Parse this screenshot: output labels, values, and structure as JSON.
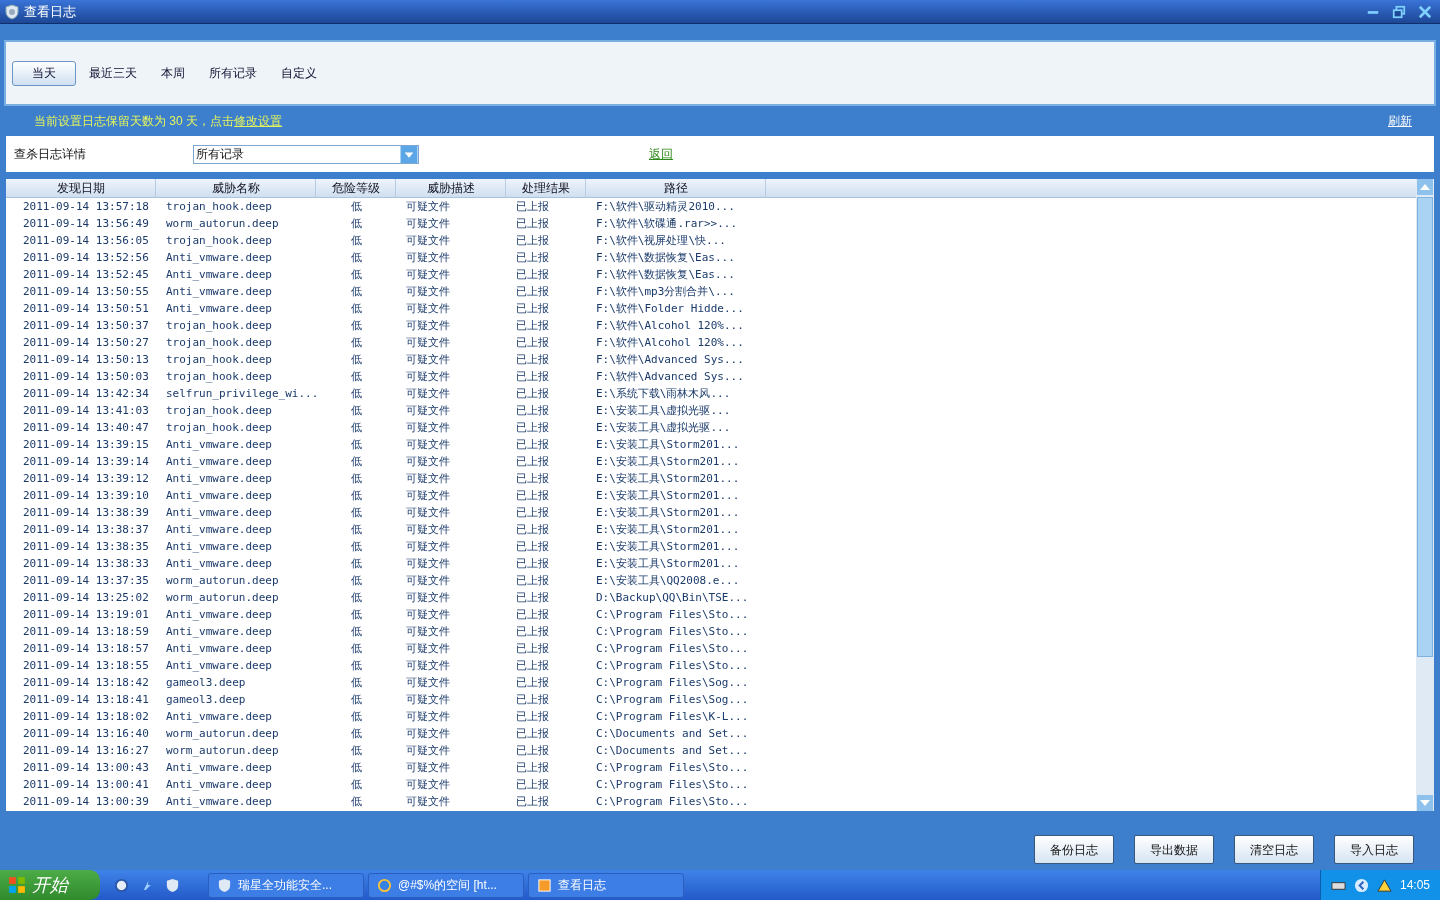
{
  "window": {
    "title": "查看日志"
  },
  "tabs": [
    {
      "label": "当天",
      "selected": true
    },
    {
      "label": "最近三天",
      "selected": false
    },
    {
      "label": "本周",
      "selected": false
    },
    {
      "label": "所有记录",
      "selected": false
    },
    {
      "label": "自定义",
      "selected": false
    }
  ],
  "notice": {
    "text": "当前设置日志保留天数为 30 天，点击",
    "link": "修改设置"
  },
  "refresh_link": "刷新",
  "filter": {
    "label": "查杀日志详情",
    "value": "所有记录"
  },
  "back_link": "返回",
  "table": {
    "columns": [
      "发现日期",
      "威胁名称",
      "危险等级",
      "威胁描述",
      "处理结果",
      "路径"
    ],
    "rows": [
      [
        "2011-09-14 13:57:18",
        "trojan_hook.deep",
        "低",
        "可疑文件",
        "已上报",
        "F:\\软件\\驱动精灵2010..."
      ],
      [
        "2011-09-14 13:56:49",
        "worm_autorun.deep",
        "低",
        "可疑文件",
        "已上报",
        "F:\\软件\\软碟通.rar>>..."
      ],
      [
        "2011-09-14 13:56:05",
        "trojan_hook.deep",
        "低",
        "可疑文件",
        "已上报",
        "F:\\软件\\视屏处理\\快..."
      ],
      [
        "2011-09-14 13:52:56",
        "Anti_vmware.deep",
        "低",
        "可疑文件",
        "已上报",
        "F:\\软件\\数据恢复\\Eas..."
      ],
      [
        "2011-09-14 13:52:45",
        "Anti_vmware.deep",
        "低",
        "可疑文件",
        "已上报",
        "F:\\软件\\数据恢复\\Eas..."
      ],
      [
        "2011-09-14 13:50:55",
        "Anti_vmware.deep",
        "低",
        "可疑文件",
        "已上报",
        "F:\\软件\\mp3分割合并\\..."
      ],
      [
        "2011-09-14 13:50:51",
        "Anti_vmware.deep",
        "低",
        "可疑文件",
        "已上报",
        "F:\\软件\\Folder Hidde..."
      ],
      [
        "2011-09-14 13:50:37",
        "trojan_hook.deep",
        "低",
        "可疑文件",
        "已上报",
        "F:\\软件\\Alcohol 120%..."
      ],
      [
        "2011-09-14 13:50:27",
        "trojan_hook.deep",
        "低",
        "可疑文件",
        "已上报",
        "F:\\软件\\Alcohol 120%..."
      ],
      [
        "2011-09-14 13:50:13",
        "trojan_hook.deep",
        "低",
        "可疑文件",
        "已上报",
        "F:\\软件\\Advanced Sys..."
      ],
      [
        "2011-09-14 13:50:03",
        "trojan_hook.deep",
        "低",
        "可疑文件",
        "已上报",
        "F:\\软件\\Advanced Sys..."
      ],
      [
        "2011-09-14 13:42:34",
        "selfrun_privilege_wi...",
        "低",
        "可疑文件",
        "已上报",
        "E:\\系统下载\\雨林木风..."
      ],
      [
        "2011-09-14 13:41:03",
        "trojan_hook.deep",
        "低",
        "可疑文件",
        "已上报",
        "E:\\安装工具\\虚拟光驱..."
      ],
      [
        "2011-09-14 13:40:47",
        "trojan_hook.deep",
        "低",
        "可疑文件",
        "已上报",
        "E:\\安装工具\\虚拟光驱..."
      ],
      [
        "2011-09-14 13:39:15",
        "Anti_vmware.deep",
        "低",
        "可疑文件",
        "已上报",
        "E:\\安装工具\\Storm201..."
      ],
      [
        "2011-09-14 13:39:14",
        "Anti_vmware.deep",
        "低",
        "可疑文件",
        "已上报",
        "E:\\安装工具\\Storm201..."
      ],
      [
        "2011-09-14 13:39:12",
        "Anti_vmware.deep",
        "低",
        "可疑文件",
        "已上报",
        "E:\\安装工具\\Storm201..."
      ],
      [
        "2011-09-14 13:39:10",
        "Anti_vmware.deep",
        "低",
        "可疑文件",
        "已上报",
        "E:\\安装工具\\Storm201..."
      ],
      [
        "2011-09-14 13:38:39",
        "Anti_vmware.deep",
        "低",
        "可疑文件",
        "已上报",
        "E:\\安装工具\\Storm201..."
      ],
      [
        "2011-09-14 13:38:37",
        "Anti_vmware.deep",
        "低",
        "可疑文件",
        "已上报",
        "E:\\安装工具\\Storm201..."
      ],
      [
        "2011-09-14 13:38:35",
        "Anti_vmware.deep",
        "低",
        "可疑文件",
        "已上报",
        "E:\\安装工具\\Storm201..."
      ],
      [
        "2011-09-14 13:38:33",
        "Anti_vmware.deep",
        "低",
        "可疑文件",
        "已上报",
        "E:\\安装工具\\Storm201..."
      ],
      [
        "2011-09-14 13:37:35",
        "worm_autorun.deep",
        "低",
        "可疑文件",
        "已上报",
        "E:\\安装工具\\QQ2008.e..."
      ],
      [
        "2011-09-14 13:25:02",
        "worm_autorun.deep",
        "低",
        "可疑文件",
        "已上报",
        "D:\\Backup\\QQ\\Bin\\TSE..."
      ],
      [
        "2011-09-14 13:19:01",
        "Anti_vmware.deep",
        "低",
        "可疑文件",
        "已上报",
        "C:\\Program Files\\Sto..."
      ],
      [
        "2011-09-14 13:18:59",
        "Anti_vmware.deep",
        "低",
        "可疑文件",
        "已上报",
        "C:\\Program Files\\Sto..."
      ],
      [
        "2011-09-14 13:18:57",
        "Anti_vmware.deep",
        "低",
        "可疑文件",
        "已上报",
        "C:\\Program Files\\Sto..."
      ],
      [
        "2011-09-14 13:18:55",
        "Anti_vmware.deep",
        "低",
        "可疑文件",
        "已上报",
        "C:\\Program Files\\Sto..."
      ],
      [
        "2011-09-14 13:18:42",
        "gameol3.deep",
        "低",
        "可疑文件",
        "已上报",
        "C:\\Program Files\\Sog..."
      ],
      [
        "2011-09-14 13:18:41",
        "gameol3.deep",
        "低",
        "可疑文件",
        "已上报",
        "C:\\Program Files\\Sog..."
      ],
      [
        "2011-09-14 13:18:02",
        "Anti_vmware.deep",
        "低",
        "可疑文件",
        "已上报",
        "C:\\Program Files\\K-L..."
      ],
      [
        "2011-09-14 13:16:40",
        "worm_autorun.deep",
        "低",
        "可疑文件",
        "已上报",
        "C:\\Documents and Set..."
      ],
      [
        "2011-09-14 13:16:27",
        "worm_autorun.deep",
        "低",
        "可疑文件",
        "已上报",
        "C:\\Documents and Set..."
      ],
      [
        "2011-09-14 13:00:43",
        "Anti_vmware.deep",
        "低",
        "可疑文件",
        "已上报",
        "C:\\Program Files\\Sto..."
      ],
      [
        "2011-09-14 13:00:41",
        "Anti_vmware.deep",
        "低",
        "可疑文件",
        "已上报",
        "C:\\Program Files\\Sto..."
      ],
      [
        "2011-09-14 13:00:39",
        "Anti_vmware.deep",
        "低",
        "可疑文件",
        "已上报",
        "C:\\Program Files\\Sto..."
      ]
    ]
  },
  "buttons": [
    "备份日志",
    "导出数据",
    "清空日志",
    "导入日志"
  ],
  "taskbar": {
    "start": "开始",
    "tasks": [
      "瑞星全功能安全...",
      "@#$%的空间 [ht...",
      "查看日志"
    ],
    "clock": "14:05"
  }
}
